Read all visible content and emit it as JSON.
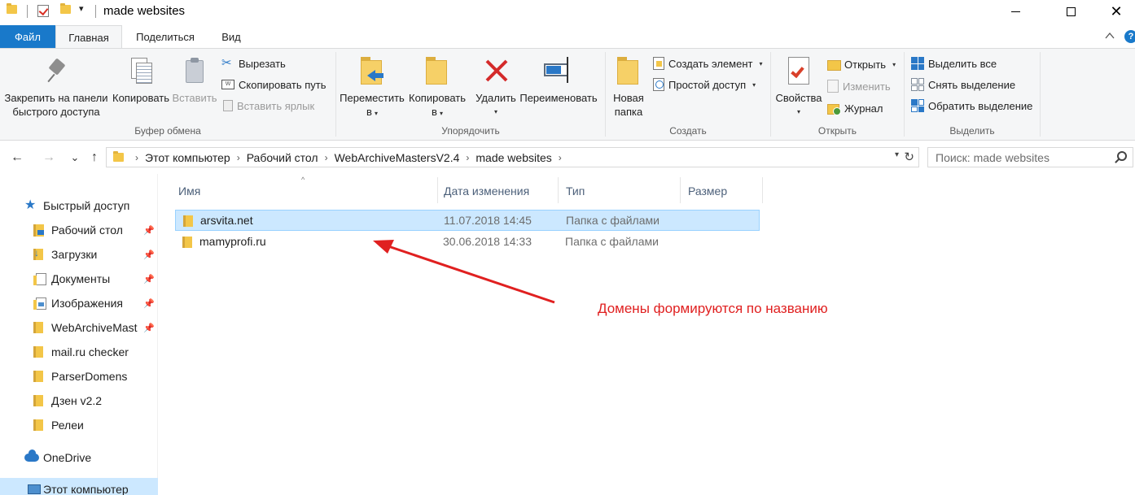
{
  "window": {
    "title": "made websites",
    "controls": {
      "minimize": "minimize",
      "maximize": "maximize",
      "close": "✕"
    }
  },
  "ribbon_tabs": [
    {
      "label": "Файл"
    },
    {
      "label": "Главная"
    },
    {
      "label": "Поделиться"
    },
    {
      "label": "Вид"
    }
  ],
  "help": {
    "label": "?"
  },
  "ribbon": {
    "clipboard": {
      "label": "Буфер обмена",
      "pin": {
        "line1": "Закрепить на панели",
        "line2": "быстрого доступа"
      },
      "copy": "Копировать",
      "paste": "Вставить",
      "cut": "Вырезать",
      "copy_path": "Скопировать путь",
      "paste_shortcut": "Вставить ярлык"
    },
    "organize": {
      "label": "Упорядочить",
      "move": {
        "line1": "Переместить",
        "line2": "в"
      },
      "copy_to": {
        "line1": "Копировать",
        "line2": "в"
      },
      "delete": "Удалить",
      "rename": "Переименовать"
    },
    "create": {
      "label": "Создать",
      "new_folder": {
        "line1": "Новая",
        "line2": "папка"
      },
      "new_item": "Создать элемент",
      "easy_access": "Простой доступ"
    },
    "open": {
      "label": "Открыть",
      "properties": "Свойства",
      "open": "Открыть",
      "edit": "Изменить",
      "history": "Журнал"
    },
    "select": {
      "label": "Выделить",
      "select_all": "Выделить все",
      "select_none": "Снять выделение",
      "invert": "Обратить выделение"
    }
  },
  "navigation": {
    "back": "←",
    "forward": "→",
    "recent": "⌄",
    "up": "↑",
    "breadcrumb": [
      "Этот компьютер",
      "Рабочий стол",
      "WebArchiveMastersV2.4",
      "made websites"
    ],
    "refresh": "↻",
    "search_placeholder": "Поиск: made websites"
  },
  "sidebar": {
    "quick_access": "Быстрый доступ",
    "items": [
      {
        "label": "Рабочий стол",
        "pinned": true
      },
      {
        "label": "Загрузки",
        "pinned": true
      },
      {
        "label": "Документы",
        "pinned": true
      },
      {
        "label": "Изображения",
        "pinned": true
      },
      {
        "label": "WebArchiveMast",
        "pinned": true
      },
      {
        "label": "mail.ru checker",
        "pinned": false
      },
      {
        "label": "ParserDomens",
        "pinned": false
      },
      {
        "label": "Дзен v2.2",
        "pinned": false
      },
      {
        "label": "Релеи",
        "pinned": false
      }
    ],
    "onedrive": "OneDrive",
    "this_pc": "Этот компьютер"
  },
  "file_list": {
    "columns": [
      "Имя",
      "Дата изменения",
      "Тип",
      "Размер"
    ],
    "rows": [
      {
        "name": "arsvita.net",
        "date": "11.07.2018 14:45",
        "type": "Папка с файлами",
        "size": "",
        "selected": true
      },
      {
        "name": "mamyprofi.ru",
        "date": "30.06.2018 14:33",
        "type": "Папка с файлами",
        "size": "",
        "selected": false
      }
    ]
  },
  "annotation": {
    "text": "Домены формируются по названию",
    "color": "#e02020"
  },
  "colors": {
    "accent": "#1979ca",
    "selection": "#cce8ff",
    "folder": "#f3c648"
  }
}
